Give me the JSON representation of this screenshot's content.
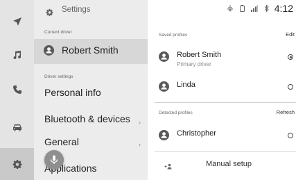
{
  "rail": {
    "items": [
      {
        "icon": "navigation-arrow-icon"
      },
      {
        "icon": "music-note-icon"
      },
      {
        "icon": "phone-icon"
      },
      {
        "icon": "car-icon"
      },
      {
        "icon": "settings-gear-icon"
      }
    ],
    "active_index": 4
  },
  "settings": {
    "title": "Settings",
    "current_driver_label": "Current driver",
    "current_driver_name": "Robert Smith",
    "driver_settings_label": "Driver settings",
    "items": [
      {
        "label": "Personal info"
      },
      {
        "label": "Bluetooth & devices",
        "chevron": "›"
      },
      {
        "label": "General",
        "chevron": "›"
      },
      {
        "label": "Applications"
      }
    ]
  },
  "status_bar": {
    "time": "4:12",
    "icons": [
      "wireless-charging-icon",
      "battery-icon",
      "signal-icon",
      "bluetooth-icon"
    ]
  },
  "profiles": {
    "saved_label": "Saved profiles",
    "edit_label": "Edit",
    "saved": [
      {
        "name": "Robert Smith",
        "subtitle": "Primary driver",
        "selected": true
      },
      {
        "name": "Linda",
        "subtitle": "",
        "selected": false
      }
    ],
    "detected_label": "Detected profiles",
    "refresh_label": "Refresh",
    "detected": [
      {
        "name": "Christopher",
        "subtitle": "",
        "selected": false
      }
    ],
    "manual_setup_label": "Manual setup"
  },
  "colors": {
    "rail_bg": "#e4e4e4",
    "rail_active_bg": "#c9c9c9",
    "list_bg": "#ececec",
    "selected_row_bg": "#d7d7d7",
    "panel_bg": "#ffffff",
    "voice_button": "#8f8f8f"
  }
}
